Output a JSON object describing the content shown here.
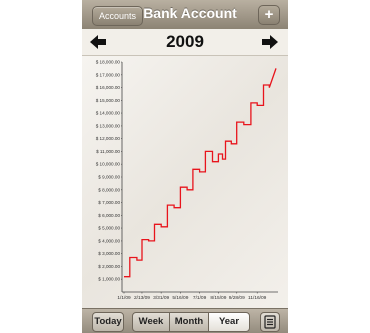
{
  "nav": {
    "back_label": "Accounts",
    "title": "Bank Account",
    "add_label": "+"
  },
  "period": {
    "year": "2009"
  },
  "toolbar": {
    "today": "Today",
    "week": "Week",
    "month": "Month",
    "year": "Year",
    "selected": "Year"
  },
  "icons": {
    "left": "arrow-left-icon",
    "right": "arrow-right-icon",
    "list": "list-icon",
    "add": "plus-icon"
  },
  "colors": {
    "line": "#e8141c",
    "nav": "#a39a8b"
  },
  "chart_data": {
    "type": "line",
    "title": "",
    "xlabel": "",
    "ylabel": "",
    "ylim": [
      0,
      18000
    ],
    "x_tick_labels": [
      "1/1/09",
      "2/13/09",
      "3/31/09",
      "5/16/09",
      "7/1/09",
      "8/15/09",
      "9/28/09",
      "11/16/09"
    ],
    "y_tick_labels": [
      "$ 1,000.00",
      "$ 2,000.00",
      "$ 3,000.00",
      "$ 4,000.00",
      "$ 5,000.00",
      "$ 6,000.00",
      "$ 7,000.00",
      "$ 8,000.00",
      "$ 9,000.00",
      "$ 10,000.00",
      "$ 11,000.00",
      "$ 12,000.00",
      "$ 13,000.00",
      "$ 14,000.00",
      "$ 15,000.00",
      "$ 16,000.00",
      "$ 17,000.00",
      "$ 18,000.00"
    ],
    "x": [
      "1/1/09",
      "1/15/09",
      "1/15/09",
      "2/1/09",
      "2/1/09",
      "2/13/09",
      "2/13/09",
      "3/1/09",
      "3/1/09",
      "3/15/09",
      "3/15/09",
      "3/31/09",
      "3/31/09",
      "4/15/09",
      "4/15/09",
      "5/1/09",
      "5/1/09",
      "5/16/09",
      "5/16/09",
      "6/1/09",
      "6/1/09",
      "6/15/09",
      "6/15/09",
      "7/1/09",
      "7/1/09",
      "7/15/09",
      "7/15/09",
      "8/1/09",
      "8/1/09",
      "8/15/09",
      "8/15/09",
      "8/25/09",
      "8/25/09",
      "9/1/09",
      "9/1/09",
      "9/15/09",
      "9/15/09",
      "9/28/09",
      "9/28/09",
      "10/15/09",
      "10/15/09",
      "11/1/09",
      "11/1/09",
      "11/16/09",
      "11/16/09",
      "12/1/09",
      "12/1/09",
      "12/15/09",
      "12/15/09",
      "12/31/09"
    ],
    "values": [
      1200,
      1200,
      2700,
      2700,
      2500,
      2500,
      4100,
      4100,
      4000,
      4000,
      5300,
      5300,
      5100,
      5100,
      6800,
      6800,
      6600,
      6600,
      8200,
      8200,
      8000,
      8000,
      9600,
      9600,
      9400,
      9400,
      11000,
      11000,
      10200,
      10200,
      10800,
      10800,
      10400,
      10400,
      11800,
      11800,
      11600,
      11600,
      13300,
      13300,
      13100,
      13100,
      14800,
      14800,
      14600,
      14600,
      16200,
      16200,
      16000,
      17500
    ]
  }
}
